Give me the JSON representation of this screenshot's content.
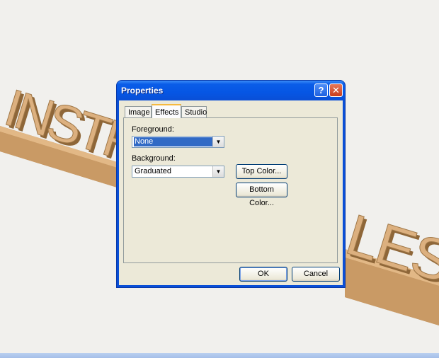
{
  "dialog": {
    "title": "Properties",
    "help_glyph": "?",
    "close_glyph": "✕",
    "tabs": [
      {
        "label": "Image",
        "active": false
      },
      {
        "label": "Effects",
        "active": true
      },
      {
        "label": "Studio",
        "active": false
      }
    ],
    "foreground": {
      "label": "Foreground:",
      "value": "None"
    },
    "background": {
      "label": "Background:",
      "value": "Graduated"
    },
    "top_color_button": "Top Color...",
    "bottom_color_button": "Bottom Color...",
    "ok_button": "OK",
    "cancel_button": "Cancel",
    "dropdown_arrow": "▼"
  },
  "scene": {
    "text_left": "INSTF",
    "text_right": "LES",
    "colors": {
      "face": "#dcb07f",
      "side": "#b98a57",
      "shadow": "#8e6638"
    }
  }
}
